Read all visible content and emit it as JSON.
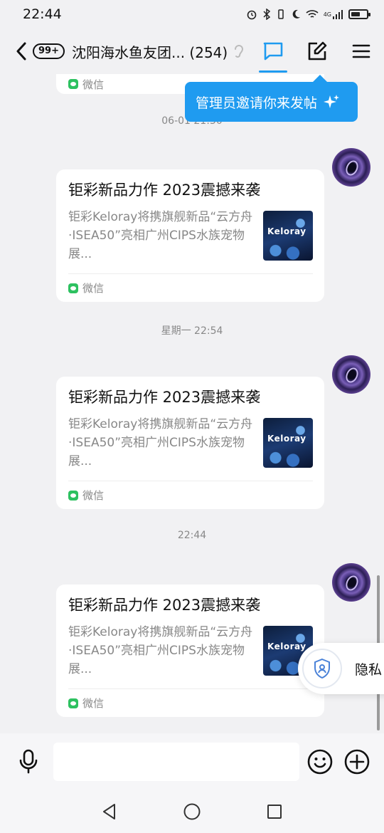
{
  "status": {
    "time": "22:44",
    "network": "4G"
  },
  "header": {
    "unread_badge": "99+",
    "title": "沈阳海水鱼友团... (254)"
  },
  "tooltip": {
    "text": "管理员邀请你来发帖"
  },
  "messages": {
    "top_footer_source": "微信",
    "ts1": "06-01 21:30",
    "ts2": "星期一 22:54",
    "ts3": "22:44",
    "card1": {
      "title": "钜彩新品力作 2023震撼来袭",
      "desc": "钜彩Keloray将携旗舰新品“云方舟·ISEA50”亮相广州CIPS水族宠物展...",
      "thumb_text": "Keloray",
      "source": "微信"
    },
    "card2": {
      "title": "钜彩新品力作 2023震撼来袭",
      "desc": "钜彩Keloray将携旗舰新品“云方舟·ISEA50”亮相广州CIPS水族宠物展...",
      "thumb_text": "Keloray",
      "source": "微信"
    },
    "card3": {
      "title": "钜彩新品力作 2023震撼来袭",
      "desc": "钜彩Keloray将携旗舰新品“云方舟·ISEA50”亮相广州CIPS水族宠物展...",
      "thumb_text": "Keloray",
      "source": "微信"
    }
  },
  "privacy": {
    "label": "隐私"
  },
  "colors": {
    "accent": "#1f9bf0",
    "wechat_green": "#2dc160",
    "background": "#f1f1f3"
  },
  "icons": [
    "back-chevron-icon",
    "chat-bubble-icon",
    "edit-icon",
    "menu-icon",
    "ear-icon",
    "sparkle-icon",
    "mic-icon",
    "emoji-icon",
    "plus-icon",
    "privacy-shield-icon",
    "back-triangle-icon",
    "home-circle-icon",
    "recents-square-icon"
  ]
}
